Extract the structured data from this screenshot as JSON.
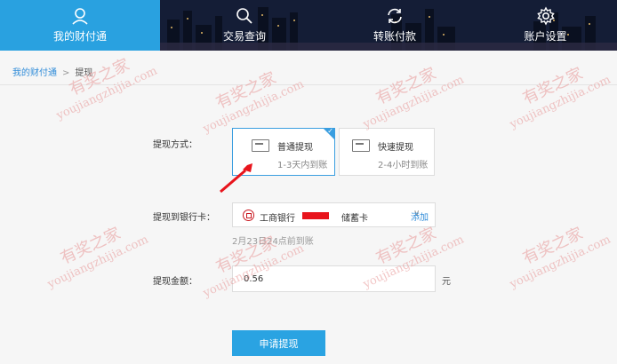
{
  "nav": {
    "items": [
      {
        "label": "我的财付通",
        "icon": "user-icon",
        "active": true
      },
      {
        "label": "交易查询",
        "icon": "search-icon",
        "active": false
      },
      {
        "label": "转账付款",
        "icon": "refresh-icon",
        "active": false
      },
      {
        "label": "账户设置",
        "icon": "gear-icon",
        "active": false
      }
    ],
    "active_color": "#29a1e0"
  },
  "breadcrumb": {
    "parent": "我的财付通",
    "separator": ">",
    "current": "提现"
  },
  "form": {
    "method_label": "提现方式：",
    "methods": [
      {
        "title": "普通提现",
        "subtitle": "1-3天内到账",
        "selected": true
      },
      {
        "title": "快速提现",
        "subtitle": "2-4小时到账",
        "selected": false
      }
    ],
    "bank_label": "提现到银行卡：",
    "bank": {
      "name": "工商银行",
      "card_type": "储蓄卡",
      "add_link": "添加",
      "arrival_note": "2月23日24点前到账"
    },
    "amount_label": "提现金额：",
    "amount_value": "0.56",
    "amount_unit": "元",
    "submit_label": "申请提现"
  },
  "watermark": {
    "cn": "有奖之家",
    "en": "youjiangzhijia.com"
  },
  "colors": {
    "accent": "#2aa3e2",
    "link": "#2e8bd8",
    "annotation_arrow": "#e8141c"
  }
}
